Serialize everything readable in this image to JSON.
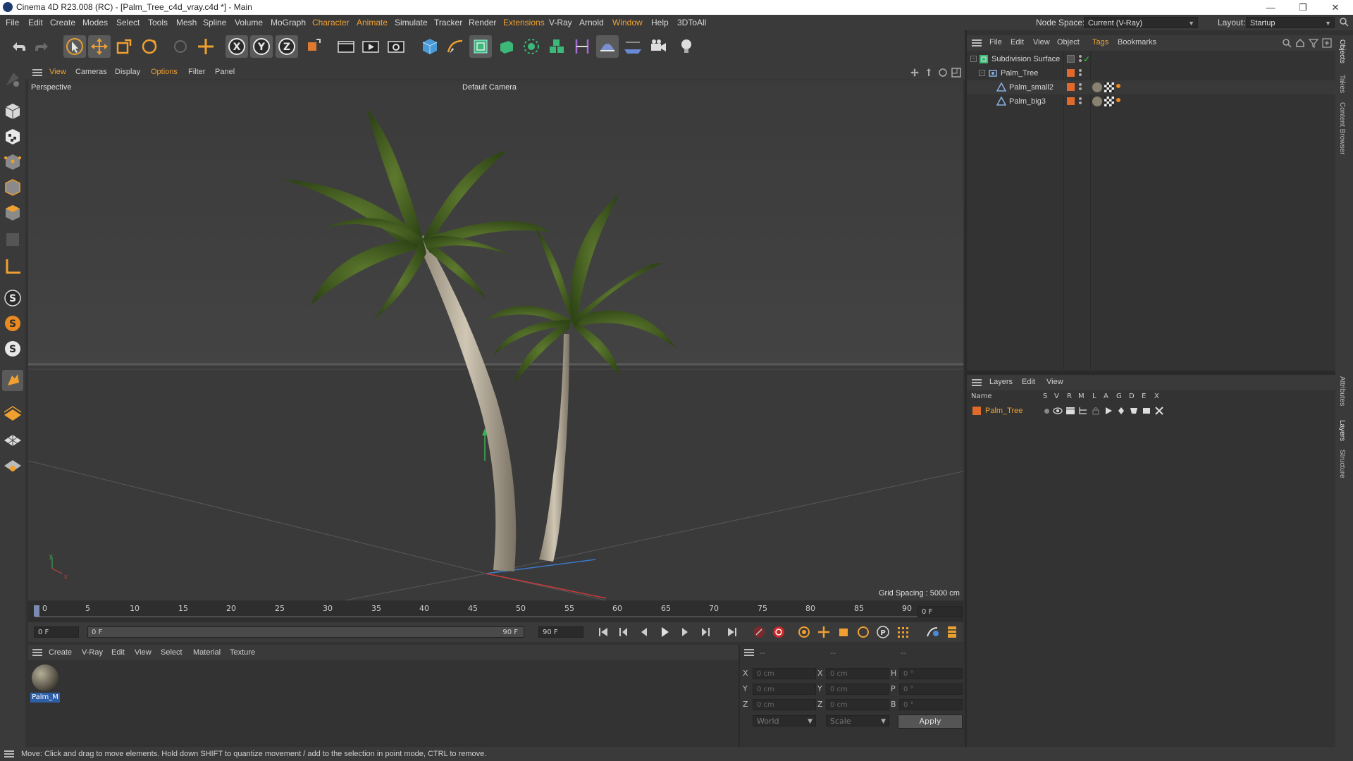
{
  "window": {
    "title": "Cinema 4D R23.008 (RC) - [Palm_Tree_c4d_vray.c4d *] - Main",
    "minimize": "—",
    "restore": "❐",
    "close": "✕"
  },
  "menubar": {
    "items": [
      "File",
      "Edit",
      "Create",
      "Modes",
      "Select",
      "Tools",
      "Mesh",
      "Spline",
      "Volume",
      "MoGraph",
      "Character",
      "Animate",
      "Simulate",
      "Tracker",
      "Render",
      "Extensions",
      "V-Ray",
      "Arnold",
      "Window",
      "Help",
      "3DToAll"
    ],
    "node_space_label": "Node Space:",
    "node_space_value": "Current (V-Ray)",
    "layout_label": "Layout:",
    "layout_value": "Startup"
  },
  "viewport": {
    "menu": [
      "View",
      "Cameras",
      "Display",
      "Options",
      "Filter",
      "Panel"
    ],
    "view_name": "Perspective",
    "camera": "Default Camera",
    "grid_spacing": "Grid Spacing : 5000 cm",
    "axis_y": "y",
    "axis_x": "x"
  },
  "timeline": {
    "ticks": [
      "0",
      "5",
      "10",
      "15",
      "20",
      "25",
      "30",
      "35",
      "40",
      "45",
      "50",
      "55",
      "60",
      "65",
      "70",
      "75",
      "80",
      "85",
      "90"
    ],
    "current_frame": "0 F",
    "start_field": "0 F",
    "range_start": "0 F",
    "range_end": "90 F",
    "end_field": "90 F"
  },
  "materials": {
    "menu": [
      "Create",
      "V-Ray",
      "Edit",
      "View",
      "Select",
      "Material",
      "Texture"
    ],
    "items": [
      {
        "name": "Palm_M"
      }
    ]
  },
  "coordinates": {
    "header": [
      "--",
      "--",
      "--"
    ],
    "rows": [
      {
        "a": "X",
        "a_val": "0 cm",
        "b": "X",
        "b_val": "0 cm",
        "c": "H",
        "c_val": "0 °"
      },
      {
        "a": "Y",
        "a_val": "0 cm",
        "b": "Y",
        "b_val": "0 cm",
        "c": "P",
        "c_val": "0 °"
      },
      {
        "a": "Z",
        "a_val": "0 cm",
        "b": "Z",
        "b_val": "0 cm",
        "c": "B",
        "c_val": "0 °"
      }
    ],
    "space": "World",
    "mode": "Scale",
    "apply": "Apply"
  },
  "objects": {
    "menu": [
      "File",
      "Edit",
      "View",
      "Object",
      "Tags",
      "Bookmarks"
    ],
    "tree": [
      {
        "name": "Subdivision Surface",
        "level": 0
      },
      {
        "name": "Palm_Tree",
        "level": 1
      },
      {
        "name": "Palm_small2",
        "level": 2
      },
      {
        "name": "Palm_big3",
        "level": 2
      }
    ]
  },
  "layers": {
    "menu": [
      "Layers",
      "Edit",
      "View"
    ],
    "columns": [
      "Name",
      "S",
      "V",
      "R",
      "M",
      "L",
      "A",
      "G",
      "D",
      "E",
      "X"
    ],
    "rows": [
      {
        "name": "Palm_Tree"
      }
    ]
  },
  "side_tabs": [
    "Objects",
    "Takes",
    "Content Browser",
    "Attributes",
    "Layers",
    "Structure"
  ],
  "status": "Move: Click and drag to move elements. Hold down SHIFT to quantize movement / add to the selection in point mode, CTRL to remove.",
  "colors": {
    "accent": "#f0a030",
    "layer": "#e06a2a",
    "bg": "#323232"
  }
}
